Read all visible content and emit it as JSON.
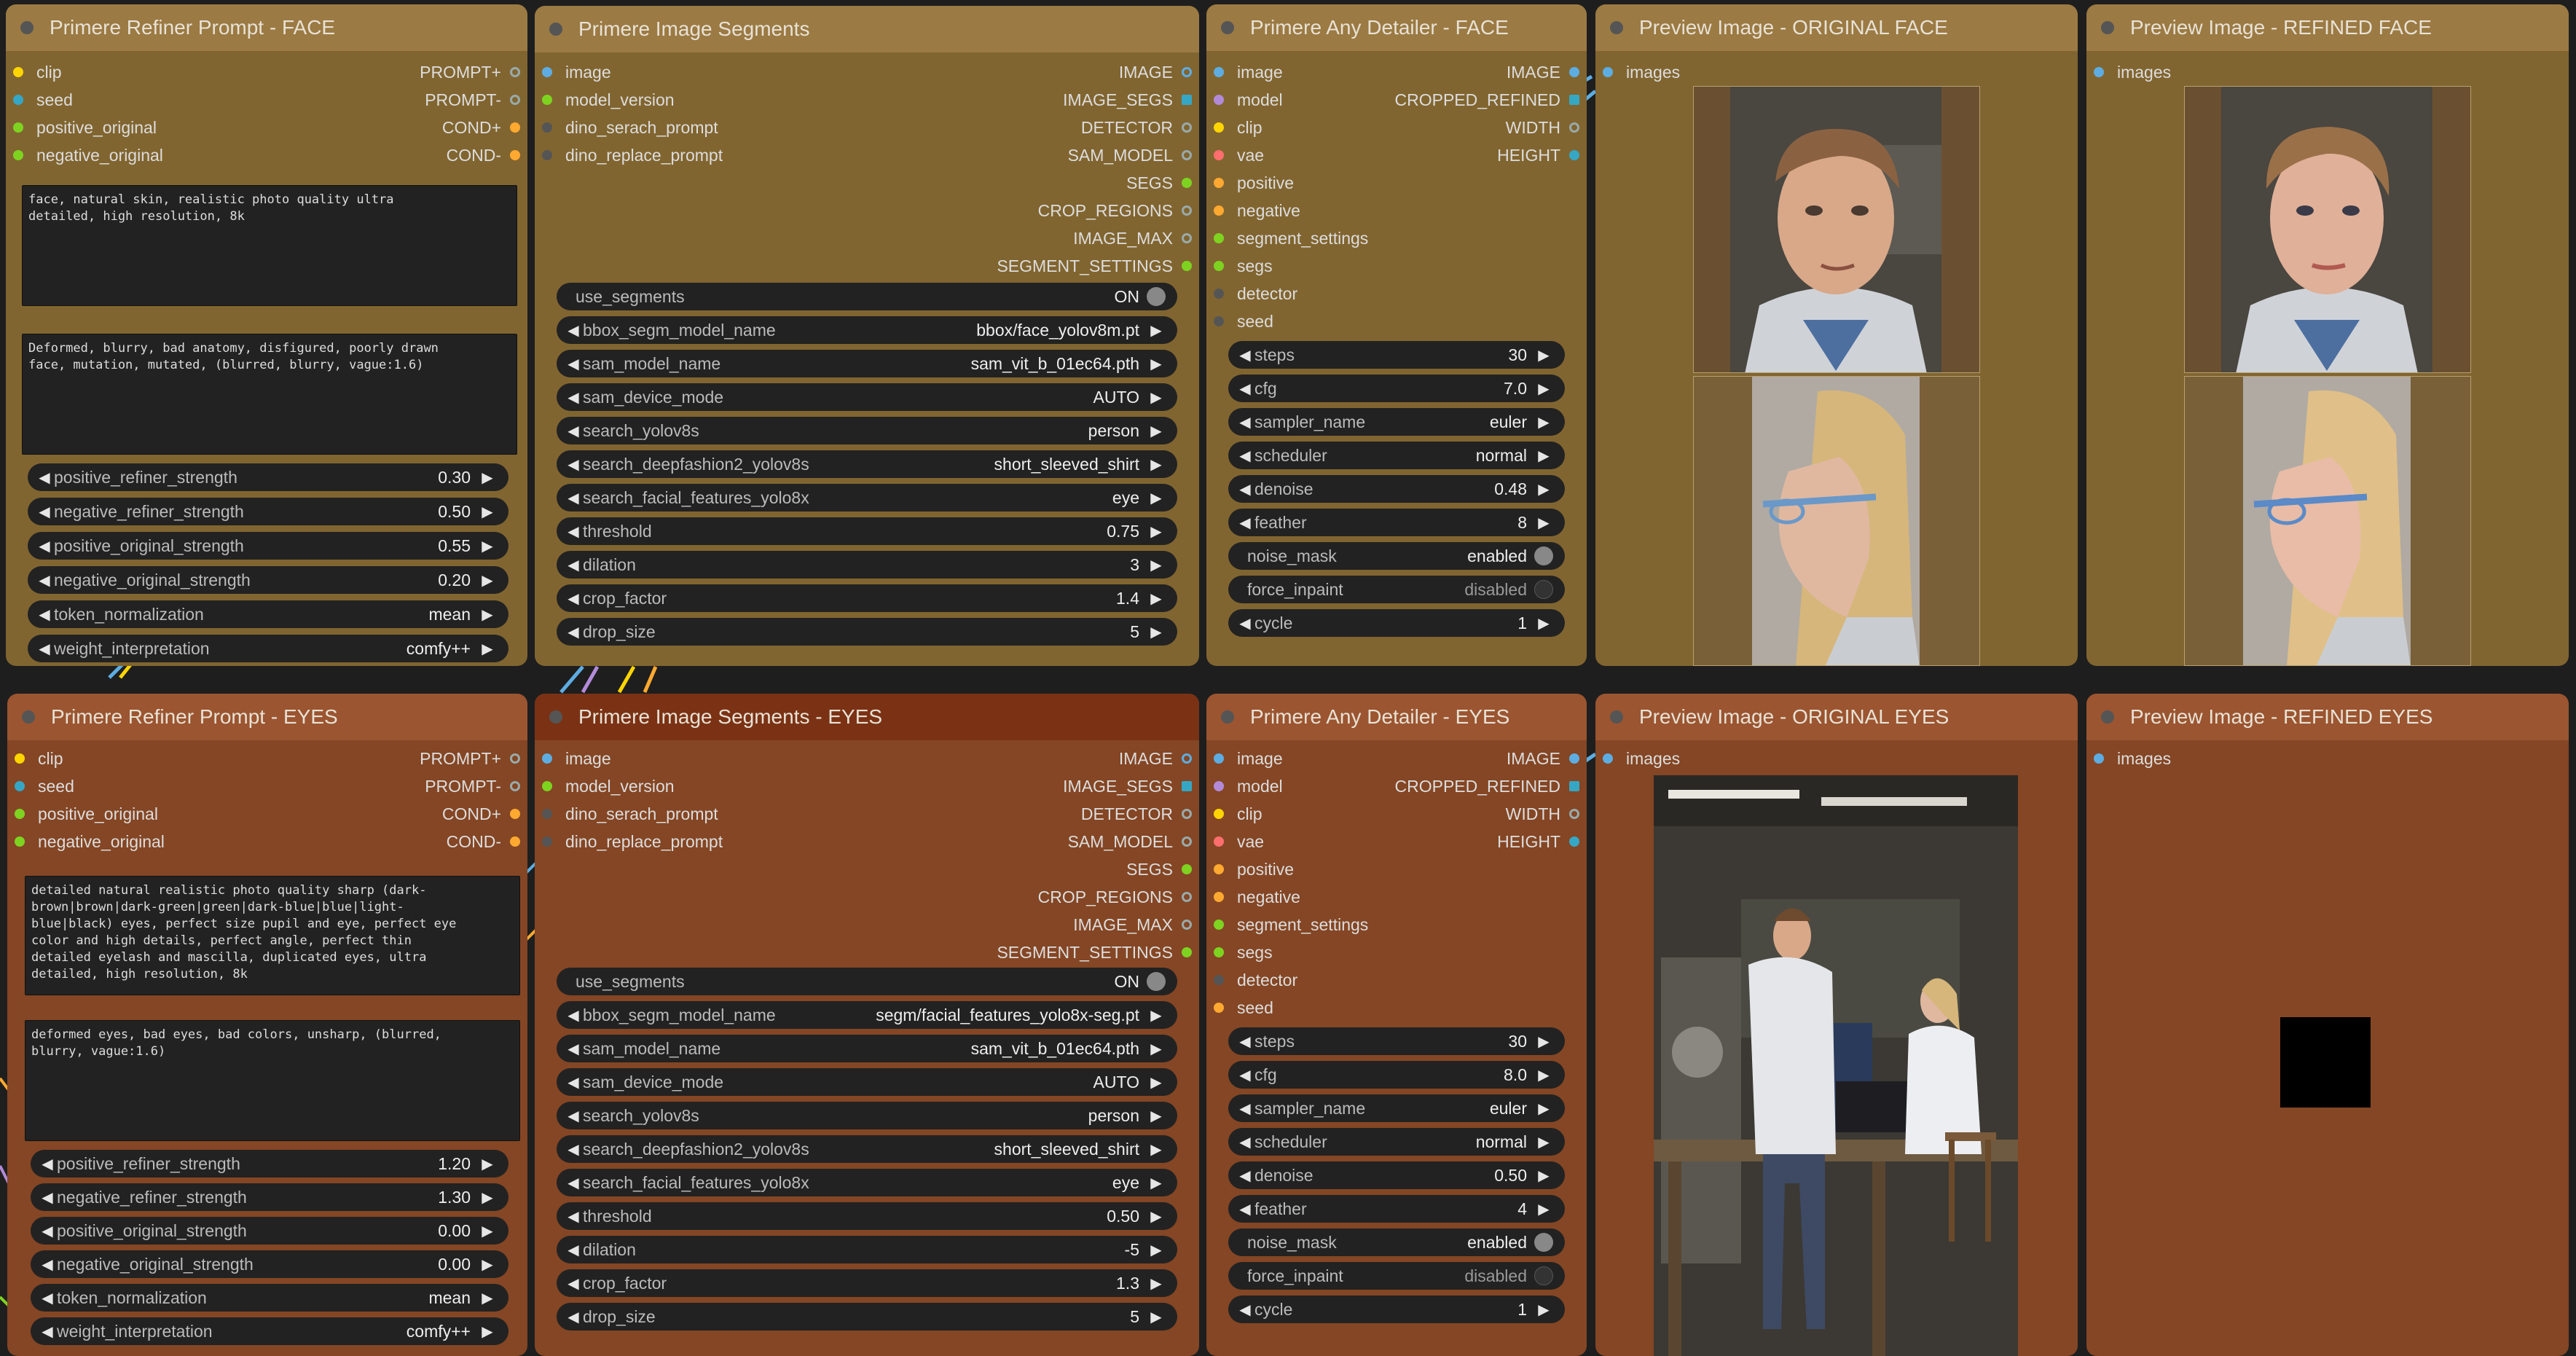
{
  "nodes": {
    "refiner_face": {
      "title": "Primere Refiner Prompt - FACE",
      "inputs": [
        "clip",
        "seed",
        "positive_original",
        "negative_original"
      ],
      "outputs": [
        "PROMPT+",
        "PROMPT-",
        "COND+",
        "COND-"
      ],
      "positive_text": "face, natural skin, realistic photo quality ultra\ndetailed, high resolution, 8k",
      "negative_text": "Deformed, blurry, bad anatomy, disfigured, poorly drawn\nface, mutation, mutated, (blurred, blurry, vague:1.6)",
      "widgets": [
        {
          "label": "positive_refiner_strength",
          "value": "0.30"
        },
        {
          "label": "negative_refiner_strength",
          "value": "0.50"
        },
        {
          "label": "positive_original_strength",
          "value": "0.55"
        },
        {
          "label": "negative_original_strength",
          "value": "0.20"
        },
        {
          "label": "token_normalization",
          "value": "mean"
        },
        {
          "label": "weight_interpretation",
          "value": "comfy++"
        }
      ]
    },
    "segments_face": {
      "title": "Primere Image Segments",
      "inputs": [
        "image",
        "model_version",
        "dino_serach_prompt",
        "dino_replace_prompt"
      ],
      "outputs": [
        "IMAGE",
        "IMAGE_SEGS",
        "DETECTOR",
        "SAM_MODEL",
        "SEGS",
        "CROP_REGIONS",
        "IMAGE_MAX",
        "SEGMENT_SETTINGS"
      ],
      "toggle": {
        "label": "use_segments",
        "value": "ON"
      },
      "widgets": [
        {
          "label": "bbox_segm_model_name",
          "value": "bbox/face_yolov8m.pt"
        },
        {
          "label": "sam_model_name",
          "value": "sam_vit_b_01ec64.pth"
        },
        {
          "label": "sam_device_mode",
          "value": "AUTO"
        },
        {
          "label": "search_yolov8s",
          "value": "person"
        },
        {
          "label": "search_deepfashion2_yolov8s",
          "value": "short_sleeved_shirt"
        },
        {
          "label": "search_facial_features_yolo8x",
          "value": "eye"
        },
        {
          "label": "threshold",
          "value": "0.75"
        },
        {
          "label": "dilation",
          "value": "3"
        },
        {
          "label": "crop_factor",
          "value": "1.4"
        },
        {
          "label": "drop_size",
          "value": "5"
        }
      ]
    },
    "detailer_face": {
      "title": "Primere Any Detailer - FACE",
      "inputs": [
        "image",
        "model",
        "clip",
        "vae",
        "positive",
        "negative",
        "segment_settings",
        "segs",
        "detector",
        "seed"
      ],
      "outputs": [
        "IMAGE",
        "CROPPED_REFINED",
        "WIDTH",
        "HEIGHT"
      ],
      "widgets": [
        {
          "label": "steps",
          "value": "30"
        },
        {
          "label": "cfg",
          "value": "7.0"
        },
        {
          "label": "sampler_name",
          "value": "euler"
        },
        {
          "label": "scheduler",
          "value": "normal"
        },
        {
          "label": "denoise",
          "value": "0.48"
        },
        {
          "label": "feather",
          "value": "8"
        }
      ],
      "toggles": [
        {
          "label": "noise_mask",
          "value": "enabled"
        },
        {
          "label": "force_inpaint",
          "value": "disabled"
        }
      ],
      "cycle": {
        "label": "cycle",
        "value": "1"
      }
    },
    "preview_orig_face": {
      "title": "Preview Image - ORIGINAL FACE",
      "input": "images"
    },
    "preview_ref_face": {
      "title": "Preview Image - REFINED FACE",
      "input": "images"
    },
    "refiner_eyes": {
      "title": "Primere Refiner Prompt - EYES",
      "inputs": [
        "clip",
        "seed",
        "positive_original",
        "negative_original"
      ],
      "outputs": [
        "PROMPT+",
        "PROMPT-",
        "COND+",
        "COND-"
      ],
      "positive_text": "detailed natural realistic photo quality sharp (dark-\nbrown|brown|dark-green|green|dark-blue|blue|light-\nblue|black) eyes, perfect size pupil and eye, perfect eye\ncolor and high details, perfect angle, perfect thin\ndetailed eyelash and mascilla, duplicated eyes, ultra\ndetailed, high resolution, 8k",
      "negative_text": "deformed eyes, bad eyes, bad colors, unsharp, (blurred,\nblurry, vague:1.6)",
      "widgets": [
        {
          "label": "positive_refiner_strength",
          "value": "1.20"
        },
        {
          "label": "negative_refiner_strength",
          "value": "1.30"
        },
        {
          "label": "positive_original_strength",
          "value": "0.00"
        },
        {
          "label": "negative_original_strength",
          "value": "0.00"
        },
        {
          "label": "token_normalization",
          "value": "mean"
        },
        {
          "label": "weight_interpretation",
          "value": "comfy++"
        }
      ]
    },
    "segments_eyes": {
      "title": "Primere Image Segments - EYES",
      "inputs": [
        "image",
        "model_version",
        "dino_serach_prompt",
        "dino_replace_prompt"
      ],
      "outputs": [
        "IMAGE",
        "IMAGE_SEGS",
        "DETECTOR",
        "SAM_MODEL",
        "SEGS",
        "CROP_REGIONS",
        "IMAGE_MAX",
        "SEGMENT_SETTINGS"
      ],
      "toggle": {
        "label": "use_segments",
        "value": "ON"
      },
      "widgets": [
        {
          "label": "bbox_segm_model_name",
          "value": "segm/facial_features_yolo8x-seg.pt"
        },
        {
          "label": "sam_model_name",
          "value": "sam_vit_b_01ec64.pth"
        },
        {
          "label": "sam_device_mode",
          "value": "AUTO"
        },
        {
          "label": "search_yolov8s",
          "value": "person"
        },
        {
          "label": "search_deepfashion2_yolov8s",
          "value": "short_sleeved_shirt"
        },
        {
          "label": "search_facial_features_yolo8x",
          "value": "eye"
        },
        {
          "label": "threshold",
          "value": "0.50"
        },
        {
          "label": "dilation",
          "value": "-5"
        },
        {
          "label": "crop_factor",
          "value": "1.3"
        },
        {
          "label": "drop_size",
          "value": "5"
        }
      ]
    },
    "detailer_eyes": {
      "title": "Primere Any Detailer - EYES",
      "inputs": [
        "image",
        "model",
        "clip",
        "vae",
        "positive",
        "negative",
        "segment_settings",
        "segs",
        "detector",
        "seed"
      ],
      "outputs": [
        "IMAGE",
        "CROPPED_REFINED",
        "WIDTH",
        "HEIGHT"
      ],
      "widgets": [
        {
          "label": "steps",
          "value": "30"
        },
        {
          "label": "cfg",
          "value": "8.0"
        },
        {
          "label": "sampler_name",
          "value": "euler"
        },
        {
          "label": "scheduler",
          "value": "normal"
        },
        {
          "label": "denoise",
          "value": "0.50"
        },
        {
          "label": "feather",
          "value": "4"
        }
      ],
      "toggles": [
        {
          "label": "noise_mask",
          "value": "enabled"
        },
        {
          "label": "force_inpaint",
          "value": "disabled"
        }
      ],
      "cycle": {
        "label": "cycle",
        "value": "1"
      }
    },
    "preview_orig_eyes": {
      "title": "Preview Image - ORIGINAL EYES",
      "input": "images"
    },
    "preview_ref_eyes": {
      "title": "Preview Image - REFINED EYES",
      "input": "images"
    }
  },
  "colors": {
    "face_node_bg": "#816530",
    "eyes_node_bg": "#844624",
    "widget_bg": "#222222",
    "canvas_bg": "#1e1e1e"
  }
}
